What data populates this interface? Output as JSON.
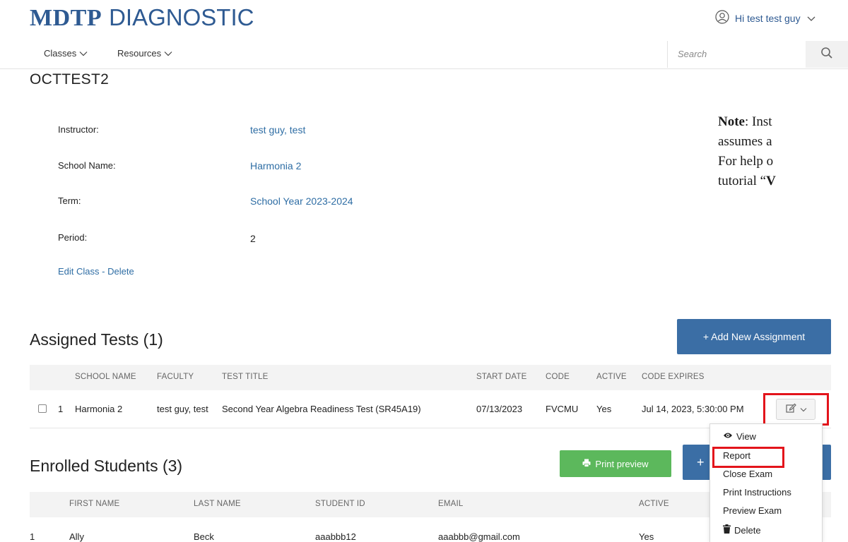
{
  "header": {
    "brand_bold": "MDTP",
    "brand_light": "DIAGNOSTIC",
    "user_greeting": "Hi test test guy"
  },
  "nav": {
    "classes": "Classes",
    "resources": "Resources",
    "search_placeholder": "Search"
  },
  "class_info": {
    "title": "OCTTEST2",
    "instructor_label": "Instructor:",
    "instructor_value": "test guy, test",
    "school_label": "School Name:",
    "school_value": "Harmonia 2",
    "term_label": "Term:",
    "term_value": "School Year 2023-2024",
    "period_label": "Period:",
    "period_value": "2",
    "edit_link": "Edit Class",
    "separator": "-",
    "delete_link": "Delete"
  },
  "note": {
    "bold": "Note",
    "line1_rest": ": Inst",
    "line2": "assumes a",
    "line3": "For help o",
    "line4_start": "tutorial “",
    "line4_bold": "V"
  },
  "assigned_tests": {
    "title": "Assigned Tests (1)",
    "add_button": "+ Add New Assignment",
    "columns": [
      "SCHOOL NAME",
      "FACULTY",
      "TEST TITLE",
      "START DATE",
      "CODE",
      "ACTIVE",
      "CODE EXPIRES"
    ],
    "rows": [
      {
        "index": "1",
        "school": "Harmonia 2",
        "faculty": "test guy, test",
        "test_title": "Second Year Algebra Readiness Test (SR45A19)",
        "start_date": "07/13/2023",
        "code": "FVCMU",
        "active": "Yes",
        "code_expires": "Jul 14, 2023, 5:30:00 PM"
      }
    ]
  },
  "action_menu": {
    "items": [
      "View",
      "Report",
      "Close Exam",
      "Print Instructions",
      "Preview Exam",
      "Delete"
    ],
    "highlighted": "Report"
  },
  "enrolled_students": {
    "title": "Enrolled Students (3)",
    "print_button": "Print preview",
    "add_button_fragment": "+",
    "columns": [
      "FIRST NAME",
      "LAST NAME",
      "STUDENT ID",
      "EMAIL",
      "ACTIVE"
    ],
    "rows": [
      {
        "index": "1",
        "first_name": "Ally",
        "last_name": "Beck",
        "student_id": "aaabbb12",
        "email": "aaabbb@gmail.com",
        "active": "Yes"
      }
    ]
  },
  "colors": {
    "brand": "#2e5a92",
    "link": "#2e6da4",
    "primary_button": "#3b6ea5",
    "success_button": "#5cb85c",
    "highlight": "#e3141b"
  }
}
